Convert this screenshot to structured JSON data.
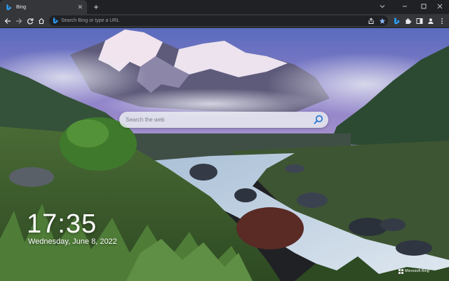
{
  "browser": {
    "tab": {
      "title": "Bing",
      "favicon": "bing-icon"
    },
    "new_tab_icon": "plus-icon",
    "window_controls": [
      "chevron-down-icon",
      "minimize-icon",
      "maximize-icon",
      "close-icon"
    ]
  },
  "toolbar": {
    "nav_icons": [
      "back-arrow-icon",
      "forward-arrow-icon",
      "reload-icon",
      "home-icon"
    ],
    "omnibox_placeholder": "Search Bing or type a URL",
    "right_icons": [
      "share-icon",
      "bookmark-star-icon",
      "bing-icon",
      "extensions-puzzle-icon",
      "side-panel-icon",
      "profile-icon",
      "more-menu-icon"
    ],
    "accent_color": "#8ab4f8"
  },
  "page": {
    "search_placeholder": "Search the web",
    "clock_time": "17:35",
    "clock_date": "Wednesday, June 8, 2022",
    "brand_label": "Microsoft Bing"
  }
}
